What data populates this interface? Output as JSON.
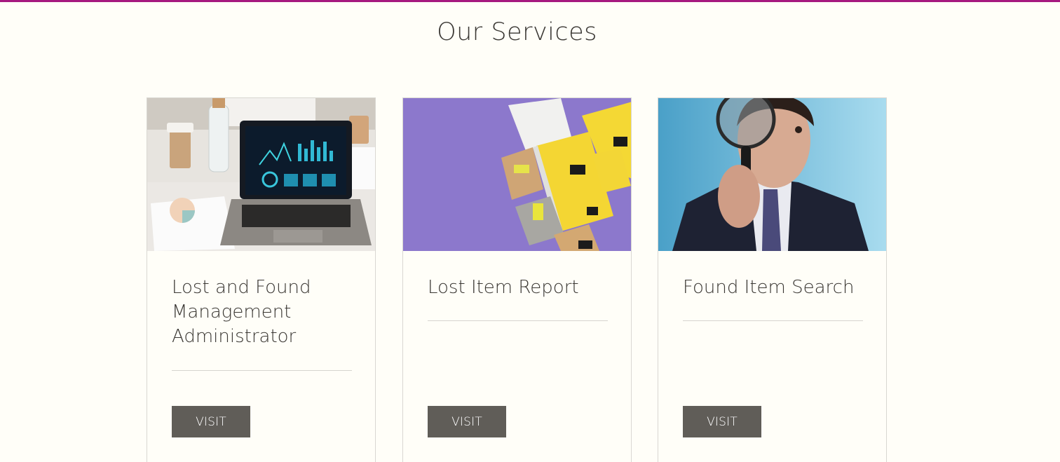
{
  "page": {
    "title": "Our Services",
    "accent_color": "#a6197f"
  },
  "services": [
    {
      "title": "Lost and Found Management Administrator",
      "image": "laptop-dashboard-image",
      "button_label": "VISIT"
    },
    {
      "title": "Lost Item Report",
      "image": "parcels-packages-image",
      "button_label": "VISIT"
    },
    {
      "title": "Found Item Search",
      "image": "magnifying-glass-man-image",
      "button_label": "VISIT"
    }
  ]
}
